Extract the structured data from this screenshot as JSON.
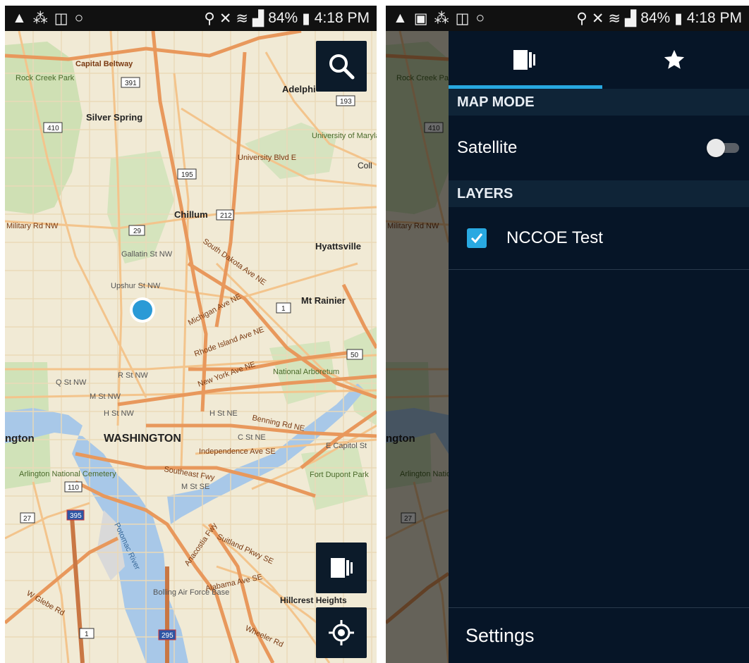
{
  "status_bar": {
    "battery_percent": "84%",
    "time": "4:18 PM"
  },
  "map": {
    "labels": {
      "capital_beltway": "Capital Beltway",
      "rock_creek_park": "Rock Creek Park",
      "silver_spring": "Silver Spring",
      "adelphi": "Adelphi",
      "university_of_maryland": "University of Maryland",
      "university_blvd": "University Blvd E",
      "chillum": "Chillum",
      "hyattsville": "Hyattsville",
      "military_rd": "Military Rd NW",
      "gallatin": "Gallatin St NW",
      "upshur": "Upshur St NW",
      "mt_rainier": "Mt Rainier",
      "south_dakota": "South Dakota Ave NE",
      "michigan": "Michigan Ave NE",
      "rhode_island": "Rhode Island Ave NE",
      "new_york": "New York Ave NE",
      "r_st": "R St NW",
      "q_st": "Q St NW",
      "m_st": "M St NW",
      "h_st": "H St NW",
      "h_st_ne": "H St NE",
      "c_st_ne": "C St NE",
      "benning": "Benning Rd NE",
      "national_arboretum": "National Arboretum",
      "washington": "WASHINGTON",
      "arlington_edge": "ngton",
      "independence": "Independence Ave SE",
      "e_capitol": "E Capitol St",
      "southeast_fwy": "Southeast Fwy",
      "m_st_se": "M St SE",
      "arlington_cemetery": "Arlington National Cemetery",
      "fort_dupont": "Fort Dupont Park",
      "potomac": "Potomac River",
      "anacostia_fwy": "Anacostia Fwy",
      "suitland": "Suitland Pkwy SE",
      "alabama": "Alabama Ave SE",
      "bolling": "Bolling Air Force Base",
      "hillcrest": "Hillcrest Heights",
      "wheeler": "Wheeler Rd",
      "glebe": "W Glebe Rd",
      "collge_edge": "Coll",
      "shield_391": "391",
      "shield_410": "410",
      "shield_193": "193",
      "shield_195": "195",
      "shield_212": "212",
      "shield_29": "29",
      "shield_1": "1",
      "shield_50": "50",
      "shield_110": "110",
      "shield_27": "27",
      "shield_395": "395",
      "shield_295": "295",
      "shield_1b": "1"
    }
  },
  "drawer": {
    "map_mode_header": "MAP MODE",
    "satellite_label": "Satellite",
    "satellite_on": false,
    "layers_header": "LAYERS",
    "layers": [
      {
        "name": "NCCOE Test",
        "checked": true
      }
    ],
    "settings_label": "Settings"
  },
  "icons": {
    "search": "search-icon",
    "layers": "layers-icon",
    "locate": "gps-locate-icon",
    "favorites": "star-icon"
  }
}
